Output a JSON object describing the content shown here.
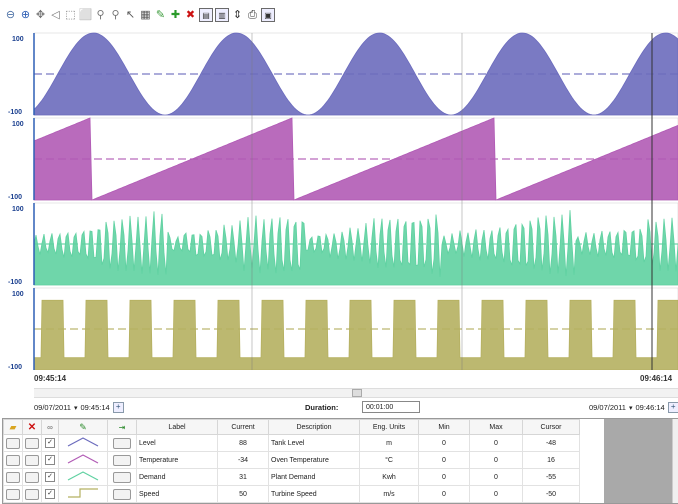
{
  "toolbar": {
    "buttons": [
      {
        "name": "zoom-out-icon",
        "glyph": "⊖",
        "color": "#4a6fa5"
      },
      {
        "name": "zoom-in-icon",
        "glyph": "⊕",
        "color": "#2e5fb5"
      },
      {
        "name": "pan-icon",
        "glyph": "✥",
        "color": "#777777"
      },
      {
        "name": "pan-left-icon",
        "glyph": "◁",
        "color": "#777777"
      },
      {
        "name": "zoom-box-icon",
        "glyph": "⬚",
        "color": "#777777"
      },
      {
        "name": "zoom-fit-icon",
        "glyph": "⬜",
        "color": "#777777"
      },
      {
        "name": "magnify-plus-icon",
        "glyph": "⚲",
        "color": "#777777"
      },
      {
        "name": "magnify-minus-icon",
        "glyph": "⚲",
        "color": "#777777"
      },
      {
        "name": "cursor-icon",
        "glyph": "↖",
        "color": "#555555"
      },
      {
        "name": "calendar-icon",
        "glyph": "▦",
        "color": "#555555"
      },
      {
        "name": "edit-pen-icon",
        "glyph": "✎",
        "color": "#3a9a3a"
      },
      {
        "name": "add-pen-icon",
        "glyph": "✚",
        "color": "#2a9a2a"
      },
      {
        "name": "remove-pen-icon",
        "glyph": "✖",
        "color": "#cc1111"
      },
      {
        "name": "stack-view-icon",
        "glyph": "▤",
        "color": "#333333",
        "boxed": true
      },
      {
        "name": "split-view-icon",
        "glyph": "▥",
        "color": "#333333",
        "boxed": true
      },
      {
        "name": "vertical-align-icon",
        "glyph": "⇕",
        "color": "#333333"
      },
      {
        "name": "print-icon",
        "glyph": "⎙",
        "color": "#333333"
      },
      {
        "name": "export-icon",
        "glyph": "▣",
        "color": "#333333",
        "boxed": true
      }
    ]
  },
  "chart_data": [
    {
      "type": "area",
      "series": [
        {
          "name": "Level",
          "color": "#6b6bbd",
          "shape": "sine",
          "period": 143
        }
      ],
      "ylim": [
        -100,
        100
      ],
      "ytick_labels": [
        "100",
        "-100"
      ]
    },
    {
      "type": "area",
      "series": [
        {
          "name": "Temperature",
          "color": "#b15bb5",
          "shape": "sawtooth",
          "period": 202
        }
      ],
      "ylim": [
        -100,
        100
      ],
      "ytick_labels": [
        "100",
        "-100"
      ]
    },
    {
      "type": "area",
      "series": [
        {
          "name": "Demand",
          "color": "#5fd1a1",
          "shape": "noise"
        }
      ],
      "ylim": [
        -100,
        100
      ],
      "ytick_labels": [
        "100",
        "-100"
      ]
    },
    {
      "type": "area",
      "series": [
        {
          "name": "Speed",
          "color": "#b5b060",
          "shape": "square",
          "period": 44
        }
      ],
      "ylim": [
        -100,
        100
      ],
      "ytick_labels": [
        "100",
        "-100"
      ]
    }
  ],
  "timeline": {
    "start_label": "09:45:14",
    "end_label": "09:46:14",
    "start_date": "09/07/2011",
    "start_time": "09:45:14",
    "end_date": "09/07/2011",
    "end_time": "09:46:14",
    "duration_label": "Duration:",
    "duration_value": "00:01:00"
  },
  "pens_table": {
    "columns": [
      "",
      "",
      "",
      "",
      "",
      "Label",
      "Current",
      "Description",
      "Eng. Units",
      "Min",
      "Max",
      "Cursor"
    ],
    "header_icons": [
      "folder-icon",
      "delete-icon",
      "link-icon",
      "edit-icon",
      "export-arrow-icon"
    ],
    "rows": [
      {
        "label": "Level",
        "current": "88",
        "description": "Tank Level",
        "units": "m",
        "min": "0",
        "max": "0",
        "cursor": "-48",
        "color": "#6b6bbd",
        "style": "triangle"
      },
      {
        "label": "Temperature",
        "current": "-34",
        "description": "Oven Temperature",
        "units": "°C",
        "min": "0",
        "max": "0",
        "cursor": "16",
        "color": "#b15bb5",
        "style": "triangle"
      },
      {
        "label": "Demand",
        "current": "31",
        "description": "Plant Demand",
        "units": "Kwh",
        "min": "0",
        "max": "0",
        "cursor": "-55",
        "color": "#5fd1a1",
        "style": "triangle"
      },
      {
        "label": "Speed",
        "current": "50",
        "description": "Turbine Speed",
        "units": "m/s",
        "min": "0",
        "max": "0",
        "cursor": "-50",
        "color": "#b5b060",
        "style": "step"
      }
    ]
  }
}
